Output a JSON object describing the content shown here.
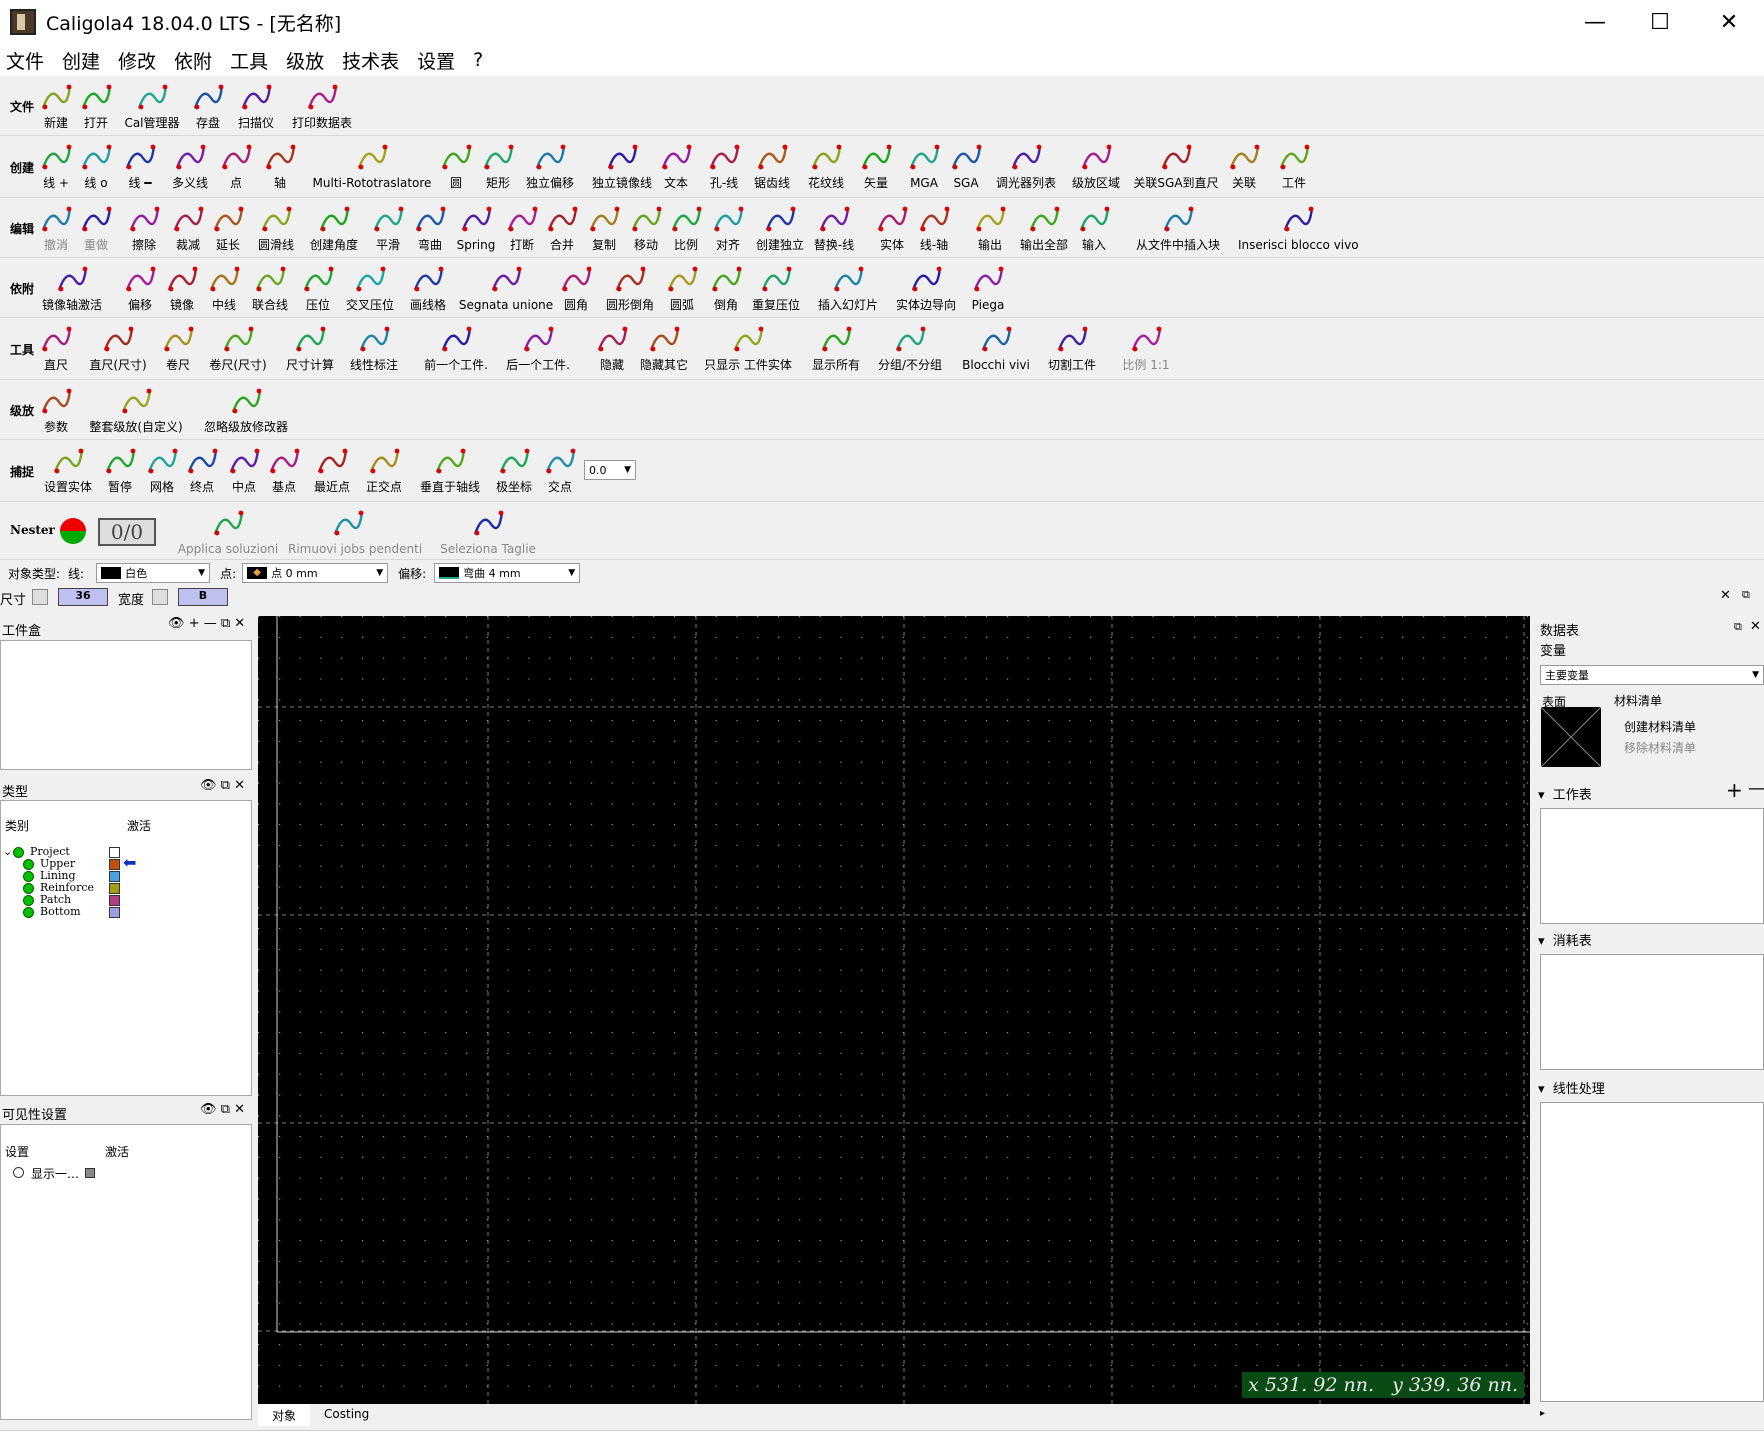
{
  "window": {
    "title": "Caligola4 18.04.0 LTS - [无名称]"
  },
  "menu": [
    "文件",
    "创建",
    "修改",
    "依附",
    "工具",
    "级放",
    "技术表",
    "设置",
    "?"
  ],
  "rows": {
    "file": {
      "label": "文件",
      "items": [
        "新建",
        "打开",
        "Cal管理器",
        "存盘",
        "扫描仪",
        "打印数据表"
      ]
    },
    "create": {
      "label": "创建",
      "items": [
        "线 +",
        "线 o",
        "线 ━",
        "多义线",
        "点",
        "轴",
        "Multi-Rototraslatore",
        "圆",
        "矩形",
        "独立偏移",
        "独立镜像线",
        "文本",
        "孔-线",
        "锯齿线",
        "花纹线",
        "矢量",
        "MGA",
        "SGA",
        "调光器列表",
        "级放区域",
        "关联SGA到直尺",
        "关联",
        "工件"
      ]
    },
    "edit": {
      "label": "编辑",
      "items": [
        "撤消",
        "重做",
        "擦除",
        "裁减",
        "延长",
        "圆滑线",
        "创建角度",
        "平滑",
        "弯曲",
        "Spring",
        "打断",
        "合并",
        "复制",
        "移动",
        "比例",
        "对齐",
        "创建独立",
        "替换-线",
        "实体",
        "线-轴",
        "输出",
        "输出全部",
        "输入",
        "从文件中插入块",
        "Inserisci blocco vivo"
      ]
    },
    "attach": {
      "label": "依附",
      "items": [
        "镜像轴激活",
        "偏移",
        "镜像",
        "中线",
        "联合线",
        "压位",
        "交叉压位",
        "画线格",
        "Segnata unione",
        "圆角",
        "圆形倒角",
        "圆弧",
        "倒角",
        "重复压位",
        "插入幻灯片",
        "实体边导向",
        "Piega"
      ]
    },
    "tools": {
      "label": "工具",
      "items": [
        "直尺",
        "直尺(尺寸)",
        "卷尺",
        "卷尺(尺寸)",
        "尺寸计算",
        "线性标注",
        "前一个工件.",
        "后一个工件.",
        "隐藏",
        "隐藏其它",
        "只显示 工件实体",
        "显示所有",
        "分组/不分组",
        "Blocchi vivi",
        "切割工件",
        "比例 1:1"
      ]
    },
    "grade": {
      "label": "级放",
      "items": [
        "参数",
        "整套级放(自定义)",
        "忽略级放修改器"
      ]
    },
    "snap": {
      "label": "捕捉",
      "items": [
        "设置实体",
        "暂停",
        "网格",
        "终点",
        "中点",
        "基点",
        "最近点",
        "正交点",
        "垂直于轴线",
        "极坐标",
        "交点"
      ],
      "value": "0.0"
    },
    "nester": {
      "label": "Nester",
      "counter": "0/0",
      "items": [
        "Applica soluzioni",
        "Rimuovi jobs pendenti",
        "Seleziona Taglie"
      ]
    }
  },
  "typebar": {
    "label": "对象类型:",
    "line_label": "线:",
    "line_value": "白色",
    "point_label": "点:",
    "point_value": "点 0 mm",
    "offset_label": "偏移:",
    "offset_value": "弯曲 4 mm"
  },
  "sizebar": {
    "size_label": "尺寸",
    "size_value": "36",
    "width_label": "宽度",
    "width_value": "B"
  },
  "toolbox": {
    "title": "工件盒"
  },
  "types": {
    "title": "类型",
    "col1": "类别",
    "col2": "激活",
    "items": [
      "Project",
      "Upper",
      "Lining",
      "Reinforce",
      "Patch",
      "Bottom"
    ],
    "colors": [
      "#ffffff",
      "#c05010",
      "#4aa0e0",
      "#a0a010",
      "#b04080",
      "#a0a0e0"
    ]
  },
  "visibility": {
    "title": "可见性设置",
    "col1": "设置",
    "col2": "激活",
    "item": "显示一…"
  },
  "canvas": {
    "coord_x": "x 531. 92 nn.",
    "coord_y": "y 339. 36 nn."
  },
  "tabs": [
    "对象",
    "Costing"
  ],
  "datasheet": {
    "title": "数据表",
    "variables_label": "变量",
    "variant": "主要变量",
    "surface_label": "表面",
    "bom_label": "材料清单",
    "create_bom": "创建材料清单",
    "remove_bom": "移除材料清单",
    "worktable": "工作表",
    "consumables": "消耗表",
    "linear": "线性处理"
  }
}
